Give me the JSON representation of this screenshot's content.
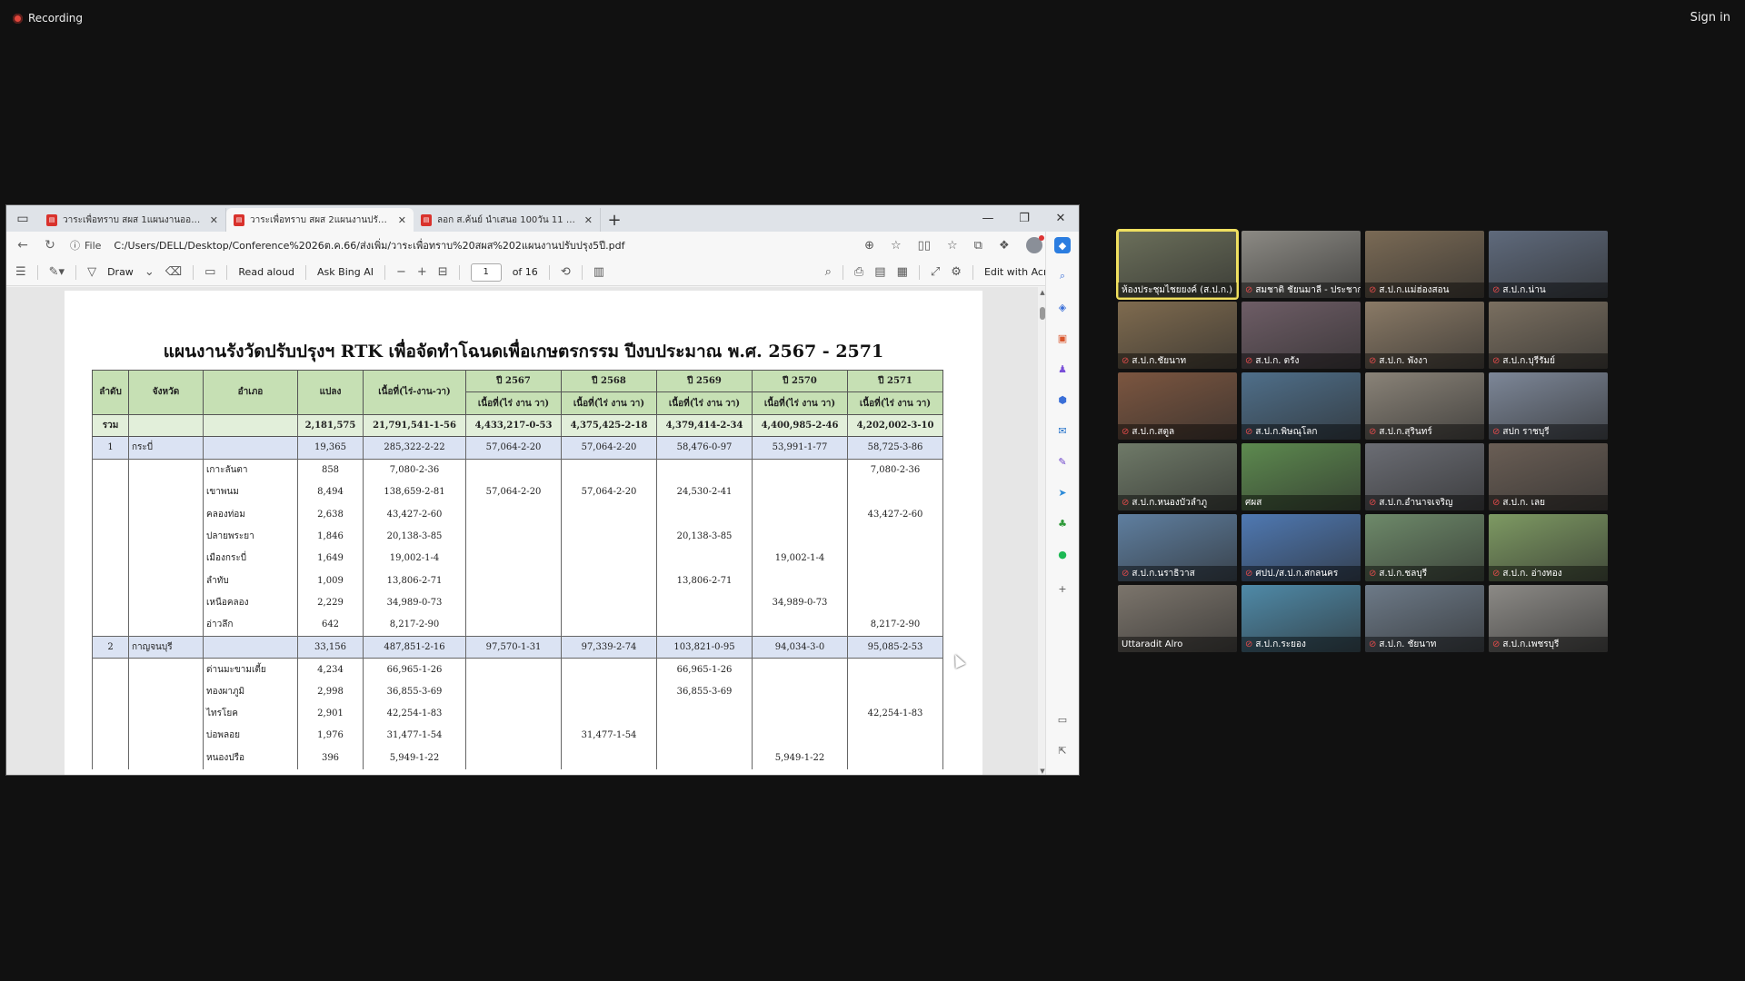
{
  "recording_label": "Recording",
  "sign_in_label": "Sign in",
  "browser": {
    "tabs": [
      {
        "label": "วาระเพื่อทราบ สผส 1แผนงานออกโฉนดเพื่อ",
        "active": false
      },
      {
        "label": "วาระเพื่อทราบ สผส 2แผนงานปรับปรุง",
        "active": true
      },
      {
        "label": "ลอก ส.ค้นย์ นำเสนอ 100วัน 11 ตค66",
        "active": false
      }
    ],
    "file_label": "File",
    "url": "C:/Users/DELL/Desktop/Conference%2026ต.ค.66/ส่งเพิ่ม/วาระเพื่อทราบ%20สผส%202แผนงานปรับปรุง5ปี.pdf",
    "toolbar": {
      "draw_label": "Draw",
      "read_aloud_label": "Read aloud",
      "ask_bing_label": "Ask Bing AI",
      "page_current": "1",
      "page_total": "of 16",
      "edit_acrobat_label": "Edit with Acrobat"
    }
  },
  "document": {
    "title": "แผนงานรังวัดปรับปรุงฯ RTK เพื่อจัดทำโฉนดเพื่อเกษตรกรรม ปีงบประมาณ พ.ศ. 2567 - 2571",
    "headers": {
      "seq": "ลำดับ",
      "province": "จังหวัด",
      "district": "อำเภอ",
      "plots": "แปลง",
      "area": "เนื้อที่(ไร่-งาน-วา)",
      "y2567": "ปี 2567",
      "y2568": "ปี 2568",
      "y2569": "ปี 2569",
      "y2570": "ปี 2570",
      "y2571": "ปี 2571",
      "sub": "เนื้อที่(ไร่ งาน วา)"
    },
    "total": {
      "label": "รวม",
      "plots": "2,181,575",
      "area": "21,791,541-1-56",
      "y2567": "4,433,217-0-53",
      "y2568": "4,375,425-2-18",
      "y2569": "4,379,414-2-34",
      "y2570": "4,400,985-2-46",
      "y2571": "4,202,002-3-10"
    },
    "rows": [
      {
        "seq": "1",
        "province": "กระบี่",
        "district": "",
        "plots": "19,365",
        "area": "285,322-2-22",
        "y2567": "57,064-2-20",
        "y2568": "57,064-2-20",
        "y2569": "58,476-0-97",
        "y2570": "53,991-1-77",
        "y2571": "58,725-3-86",
        "prov": true
      },
      {
        "seq": "",
        "province": "",
        "district": "เกาะลันตา",
        "plots": "858",
        "area": "7,080-2-36",
        "y2567": "",
        "y2568": "",
        "y2569": "",
        "y2570": "",
        "y2571": "7,080-2-36"
      },
      {
        "seq": "",
        "province": "",
        "district": "เขาพนม",
        "plots": "8,494",
        "area": "138,659-2-81",
        "y2567": "57,064-2-20",
        "y2568": "57,064-2-20",
        "y2569": "24,530-2-41",
        "y2570": "",
        "y2571": ""
      },
      {
        "seq": "",
        "province": "",
        "district": "คลองท่อม",
        "plots": "2,638",
        "area": "43,427-2-60",
        "y2567": "",
        "y2568": "",
        "y2569": "",
        "y2570": "",
        "y2571": "43,427-2-60"
      },
      {
        "seq": "",
        "province": "",
        "district": "ปลายพระยา",
        "plots": "1,846",
        "area": "20,138-3-85",
        "y2567": "",
        "y2568": "",
        "y2569": "20,138-3-85",
        "y2570": "",
        "y2571": ""
      },
      {
        "seq": "",
        "province": "",
        "district": "เมืองกระบี่",
        "plots": "1,649",
        "area": "19,002-1-4",
        "y2567": "",
        "y2568": "",
        "y2569": "",
        "y2570": "19,002-1-4",
        "y2571": ""
      },
      {
        "seq": "",
        "province": "",
        "district": "ลำทับ",
        "plots": "1,009",
        "area": "13,806-2-71",
        "y2567": "",
        "y2568": "",
        "y2569": "13,806-2-71",
        "y2570": "",
        "y2571": ""
      },
      {
        "seq": "",
        "province": "",
        "district": "เหนือคลอง",
        "plots": "2,229",
        "area": "34,989-0-73",
        "y2567": "",
        "y2568": "",
        "y2569": "",
        "y2570": "34,989-0-73",
        "y2571": ""
      },
      {
        "seq": "",
        "province": "",
        "district": "อ่าวลึก",
        "plots": "642",
        "area": "8,217-2-90",
        "y2567": "",
        "y2568": "",
        "y2569": "",
        "y2570": "",
        "y2571": "8,217-2-90"
      },
      {
        "seq": "2",
        "province": "กาญจนบุรี",
        "district": "",
        "plots": "33,156",
        "area": "487,851-2-16",
        "y2567": "97,570-1-31",
        "y2568": "97,339-2-74",
        "y2569": "103,821-0-95",
        "y2570": "94,034-3-0",
        "y2571": "95,085-2-53",
        "prov": true
      },
      {
        "seq": "",
        "province": "",
        "district": "ด่านมะขามเตี้ย",
        "plots": "4,234",
        "area": "66,965-1-26",
        "y2567": "",
        "y2568": "",
        "y2569": "66,965-1-26",
        "y2570": "",
        "y2571": ""
      },
      {
        "seq": "",
        "province": "",
        "district": "ทองผาภูมิ",
        "plots": "2,998",
        "area": "36,855-3-69",
        "y2567": "",
        "y2568": "",
        "y2569": "36,855-3-69",
        "y2570": "",
        "y2571": ""
      },
      {
        "seq": "",
        "province": "",
        "district": "ไทรโยค",
        "plots": "2,901",
        "area": "42,254-1-83",
        "y2567": "",
        "y2568": "",
        "y2569": "",
        "y2570": "",
        "y2571": "42,254-1-83"
      },
      {
        "seq": "",
        "province": "",
        "district": "บ่อพลอย",
        "plots": "1,976",
        "area": "31,477-1-54",
        "y2567": "",
        "y2568": "31,477-1-54",
        "y2569": "",
        "y2570": "",
        "y2571": ""
      },
      {
        "seq": "",
        "province": "",
        "district": "หนองปรือ",
        "plots": "396",
        "area": "5,949-1-22",
        "y2567": "",
        "y2568": "",
        "y2569": "",
        "y2570": "5,949-1-22",
        "y2571": ""
      }
    ]
  },
  "participants": [
    {
      "name": "ห้องประชุมไชยยงค์ (ส.ป.ก.)",
      "muted": false,
      "active": true,
      "color": "#6b6f5a"
    },
    {
      "name": "สมชาติ ชัยนมาลี - ประชาก...",
      "muted": true,
      "active": false,
      "color": "#8c8a84"
    },
    {
      "name": "ส.ป.ก.แม่ฮ่องสอน",
      "muted": true,
      "active": false,
      "color": "#7a6a55"
    },
    {
      "name": "ส.ป.ก.น่าน",
      "muted": true,
      "active": false,
      "color": "#5f6a7c"
    },
    {
      "name": "ส.ป.ก.ชัยนาท",
      "muted": true,
      "active": false,
      "color": "#7f6b4f"
    },
    {
      "name": "ส.ป.ก. ตรัง",
      "muted": true,
      "active": false,
      "color": "#6e5d66"
    },
    {
      "name": "ส.ป.ก. พังงา",
      "muted": true,
      "active": false,
      "color": "#8a7a66"
    },
    {
      "name": "ส.ป.ก.บุรีรัมย์",
      "muted": true,
      "active": false,
      "color": "#7a6f60"
    },
    {
      "name": "ส.ป.ก.สตูล",
      "muted": true,
      "active": false,
      "color": "#7c5640"
    },
    {
      "name": "ส.ป.ก.พิษณุโลก",
      "muted": true,
      "active": false,
      "color": "#4f6f8a"
    },
    {
      "name": "ส.ป.ก.สุรินทร์",
      "muted": true,
      "active": false,
      "color": "#8a8378"
    },
    {
      "name": "สปก ราชบุรี",
      "muted": true,
      "active": false,
      "color": "#7d8798"
    },
    {
      "name": "ส.ป.ก.หนองบัวลำภู",
      "muted": true,
      "active": false,
      "color": "#6f7a68"
    },
    {
      "name": "ศผส",
      "muted": false,
      "active": false,
      "color": "#5d8a4f"
    },
    {
      "name": "ส.ป.ก.อำนาจเจริญ",
      "muted": true,
      "active": false,
      "color": "#6b6d74"
    },
    {
      "name": "ส.ป.ก. เลย",
      "muted": true,
      "active": false,
      "color": "#6a5e55"
    },
    {
      "name": "ส.ป.ก.นราธิวาส",
      "muted": true,
      "active": false,
      "color": "#5f7fa0"
    },
    {
      "name": "ศปป./ส.ป.ก.สกลนคร",
      "muted": true,
      "active": false,
      "color": "#4f79b3"
    },
    {
      "name": "ส.ป.ก.ชลบุรี",
      "muted": true,
      "active": false,
      "color": "#6e8a6a"
    },
    {
      "name": "ส.ป.ก. อ่างทอง",
      "muted": true,
      "active": false,
      "color": "#7e9a63"
    },
    {
      "name": "Uttaradit Alro",
      "muted": false,
      "active": false,
      "color": "#7c756c"
    },
    {
      "name": "ส.ป.ก.ระยอง",
      "muted": true,
      "active": false,
      "color": "#4f8aa8"
    },
    {
      "name": "ส.ป.ก. ชัยนาท",
      "muted": true,
      "active": false,
      "color": "#6d7a88"
    },
    {
      "name": "ส.ป.ก.เพชรบุรี",
      "muted": true,
      "active": false,
      "color": "#8c8a86"
    }
  ]
}
